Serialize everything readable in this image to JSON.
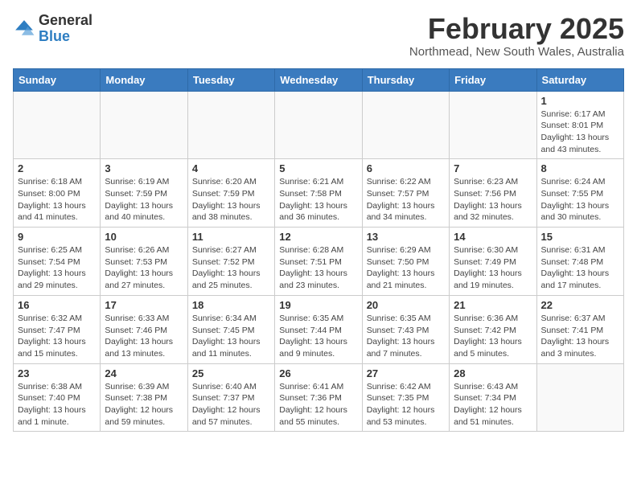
{
  "header": {
    "logo_general": "General",
    "logo_blue": "Blue",
    "main_title": "February 2025",
    "subtitle": "Northmead, New South Wales, Australia"
  },
  "calendar": {
    "headers": [
      "Sunday",
      "Monday",
      "Tuesday",
      "Wednesday",
      "Thursday",
      "Friday",
      "Saturday"
    ],
    "weeks": [
      [
        {
          "day": "",
          "info": ""
        },
        {
          "day": "",
          "info": ""
        },
        {
          "day": "",
          "info": ""
        },
        {
          "day": "",
          "info": ""
        },
        {
          "day": "",
          "info": ""
        },
        {
          "day": "",
          "info": ""
        },
        {
          "day": "1",
          "info": "Sunrise: 6:17 AM\nSunset: 8:01 PM\nDaylight: 13 hours\nand 43 minutes."
        }
      ],
      [
        {
          "day": "2",
          "info": "Sunrise: 6:18 AM\nSunset: 8:00 PM\nDaylight: 13 hours\nand 41 minutes."
        },
        {
          "day": "3",
          "info": "Sunrise: 6:19 AM\nSunset: 7:59 PM\nDaylight: 13 hours\nand 40 minutes."
        },
        {
          "day": "4",
          "info": "Sunrise: 6:20 AM\nSunset: 7:59 PM\nDaylight: 13 hours\nand 38 minutes."
        },
        {
          "day": "5",
          "info": "Sunrise: 6:21 AM\nSunset: 7:58 PM\nDaylight: 13 hours\nand 36 minutes."
        },
        {
          "day": "6",
          "info": "Sunrise: 6:22 AM\nSunset: 7:57 PM\nDaylight: 13 hours\nand 34 minutes."
        },
        {
          "day": "7",
          "info": "Sunrise: 6:23 AM\nSunset: 7:56 PM\nDaylight: 13 hours\nand 32 minutes."
        },
        {
          "day": "8",
          "info": "Sunrise: 6:24 AM\nSunset: 7:55 PM\nDaylight: 13 hours\nand 30 minutes."
        }
      ],
      [
        {
          "day": "9",
          "info": "Sunrise: 6:25 AM\nSunset: 7:54 PM\nDaylight: 13 hours\nand 29 minutes."
        },
        {
          "day": "10",
          "info": "Sunrise: 6:26 AM\nSunset: 7:53 PM\nDaylight: 13 hours\nand 27 minutes."
        },
        {
          "day": "11",
          "info": "Sunrise: 6:27 AM\nSunset: 7:52 PM\nDaylight: 13 hours\nand 25 minutes."
        },
        {
          "day": "12",
          "info": "Sunrise: 6:28 AM\nSunset: 7:51 PM\nDaylight: 13 hours\nand 23 minutes."
        },
        {
          "day": "13",
          "info": "Sunrise: 6:29 AM\nSunset: 7:50 PM\nDaylight: 13 hours\nand 21 minutes."
        },
        {
          "day": "14",
          "info": "Sunrise: 6:30 AM\nSunset: 7:49 PM\nDaylight: 13 hours\nand 19 minutes."
        },
        {
          "day": "15",
          "info": "Sunrise: 6:31 AM\nSunset: 7:48 PM\nDaylight: 13 hours\nand 17 minutes."
        }
      ],
      [
        {
          "day": "16",
          "info": "Sunrise: 6:32 AM\nSunset: 7:47 PM\nDaylight: 13 hours\nand 15 minutes."
        },
        {
          "day": "17",
          "info": "Sunrise: 6:33 AM\nSunset: 7:46 PM\nDaylight: 13 hours\nand 13 minutes."
        },
        {
          "day": "18",
          "info": "Sunrise: 6:34 AM\nSunset: 7:45 PM\nDaylight: 13 hours\nand 11 minutes."
        },
        {
          "day": "19",
          "info": "Sunrise: 6:35 AM\nSunset: 7:44 PM\nDaylight: 13 hours\nand 9 minutes."
        },
        {
          "day": "20",
          "info": "Sunrise: 6:35 AM\nSunset: 7:43 PM\nDaylight: 13 hours\nand 7 minutes."
        },
        {
          "day": "21",
          "info": "Sunrise: 6:36 AM\nSunset: 7:42 PM\nDaylight: 13 hours\nand 5 minutes."
        },
        {
          "day": "22",
          "info": "Sunrise: 6:37 AM\nSunset: 7:41 PM\nDaylight: 13 hours\nand 3 minutes."
        }
      ],
      [
        {
          "day": "23",
          "info": "Sunrise: 6:38 AM\nSunset: 7:40 PM\nDaylight: 13 hours\nand 1 minute."
        },
        {
          "day": "24",
          "info": "Sunrise: 6:39 AM\nSunset: 7:38 PM\nDaylight: 12 hours\nand 59 minutes."
        },
        {
          "day": "25",
          "info": "Sunrise: 6:40 AM\nSunset: 7:37 PM\nDaylight: 12 hours\nand 57 minutes."
        },
        {
          "day": "26",
          "info": "Sunrise: 6:41 AM\nSunset: 7:36 PM\nDaylight: 12 hours\nand 55 minutes."
        },
        {
          "day": "27",
          "info": "Sunrise: 6:42 AM\nSunset: 7:35 PM\nDaylight: 12 hours\nand 53 minutes."
        },
        {
          "day": "28",
          "info": "Sunrise: 6:43 AM\nSunset: 7:34 PM\nDaylight: 12 hours\nand 51 minutes."
        },
        {
          "day": "",
          "info": ""
        }
      ]
    ]
  }
}
